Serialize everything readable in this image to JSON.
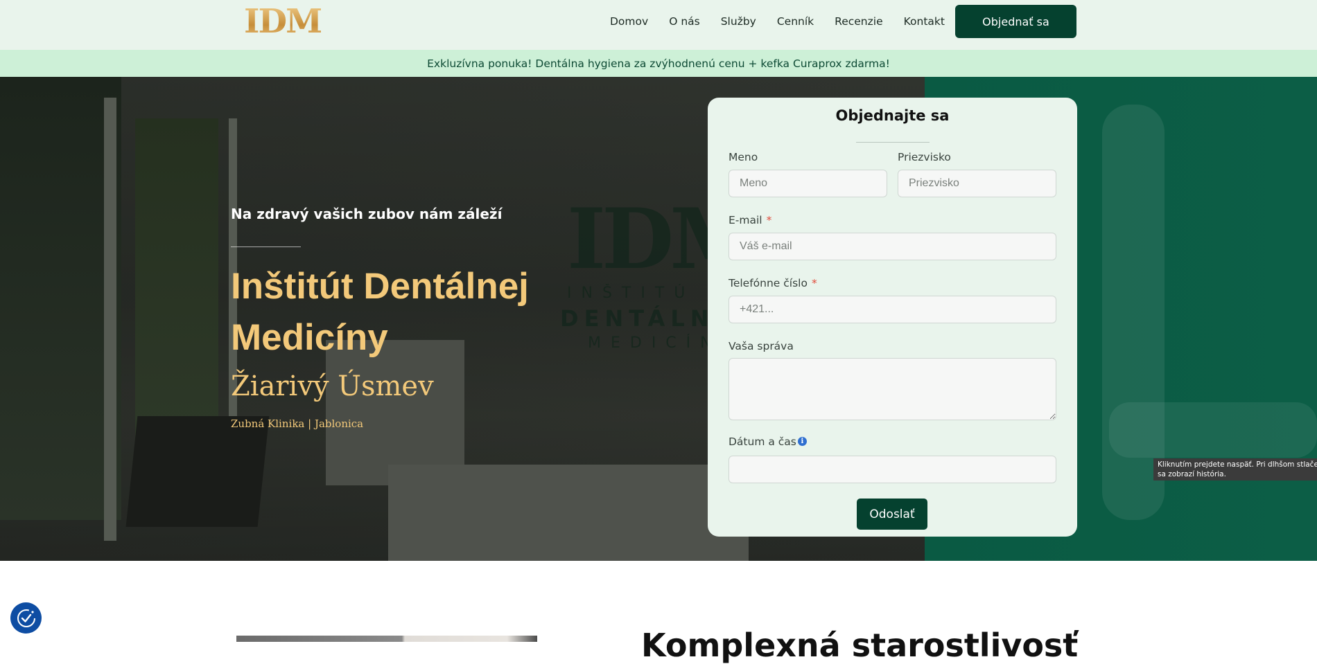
{
  "header": {
    "logo_text": "IDM",
    "nav": [
      "Domov",
      "O nás",
      "Služby",
      "Cenník",
      "Recenzie",
      "Kontakt"
    ],
    "cta_label": "Objednať sa"
  },
  "promo": {
    "text": "Exkluzívna ponuka! Dentálna hygiena za zvýhodnenú cenu + kefka Curaprox zdarma!"
  },
  "hero": {
    "tagline": "Na zdravý vašich zubov nám záleží",
    "title": "Inštitút Dentálnej Medicíny",
    "subtitle": "Žiarivý Úsmev",
    "small": "Zubná Klinika | Jablonica",
    "wall_logo": "IDM",
    "wall_logo_line1": "INŠTITÚ",
    "wall_logo_line2": "DENTÁLN",
    "wall_logo_line3": "MEDICÍN"
  },
  "form": {
    "title": "Objednajte sa",
    "first_name_label": "Meno",
    "first_name_placeholder": "Meno",
    "last_name_label": "Priezvisko",
    "last_name_placeholder": "Priezvisko",
    "email_label": "E-mail",
    "email_placeholder": "Váš e-mail",
    "phone_label": "Telefónne číslo",
    "phone_placeholder": "+421...",
    "required_mark": "*",
    "message_label": "Vaša správa",
    "datetime_label": "Dátum a čas",
    "info_glyph": "i",
    "submit_label": "Odoslať"
  },
  "tooltip": {
    "line1": "Kliknutím prejdete naspäť. Pri dlhšom stlače",
    "line2": "sa zobrazí história."
  },
  "bottom": {
    "heading": "Komplexná starostlivosť"
  },
  "colors": {
    "brand_dark_green": "#05412f",
    "header_bg": "#e9f4ec",
    "promo_bg": "#cdf0d7",
    "hero_accent_gold": "#f3c97a",
    "hero_green_panel": "#0a5a43",
    "required_red": "#e14b3b",
    "cookie_blue": "#0e4da3"
  },
  "icons": {
    "logo": "idm-tooth-logo",
    "info": "info-icon",
    "cookie": "cookie-consent-icon"
  }
}
